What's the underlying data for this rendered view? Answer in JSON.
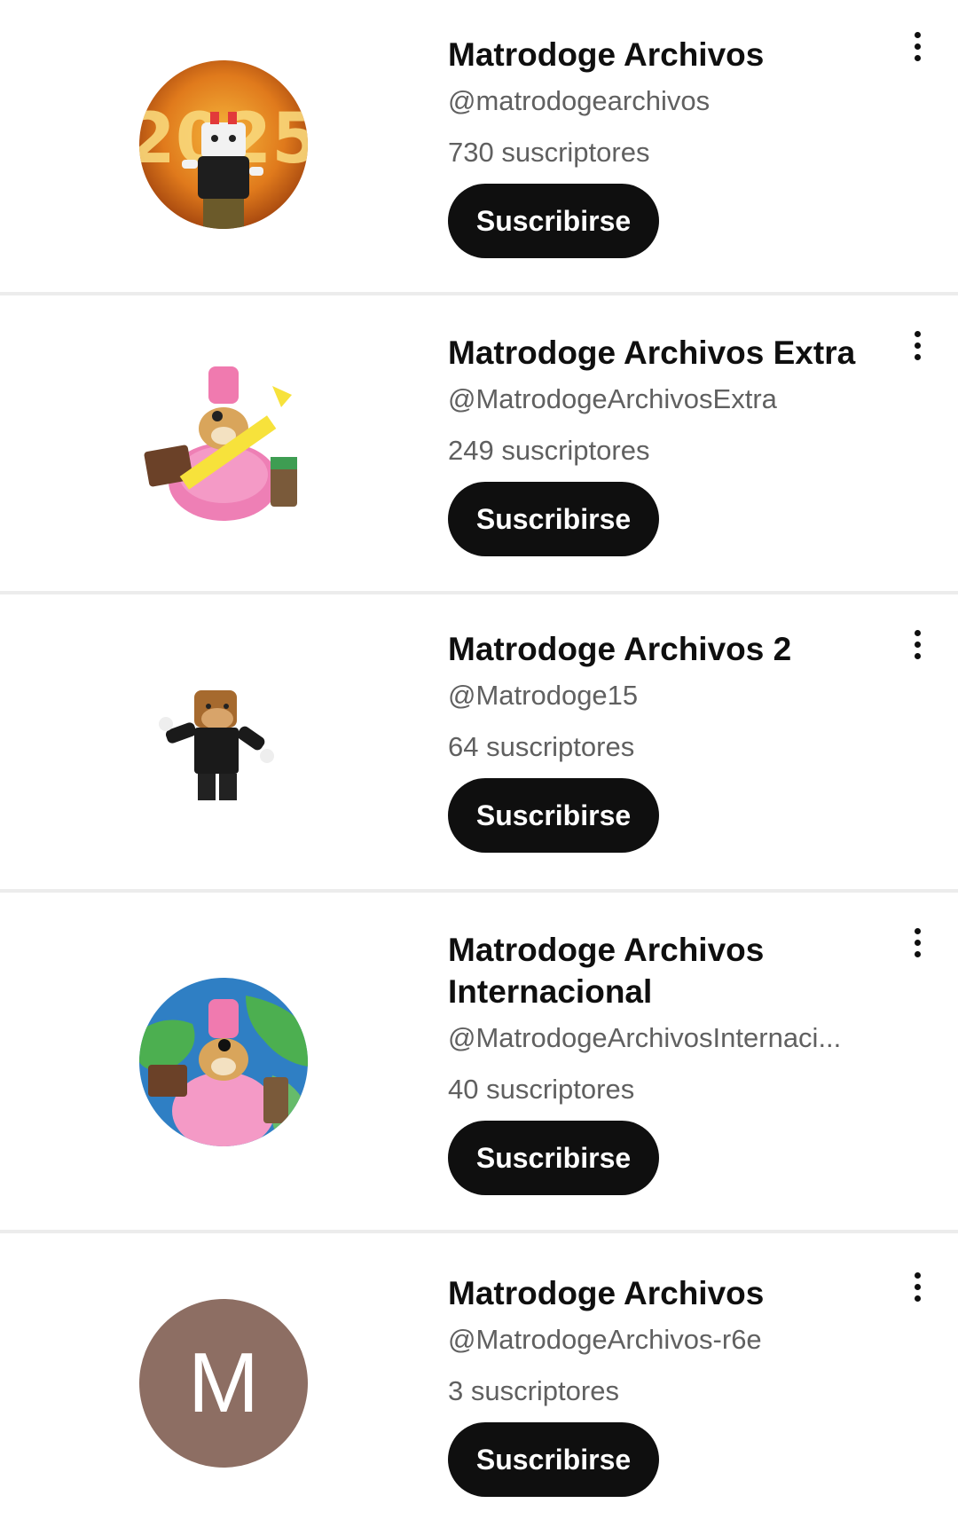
{
  "channels": [
    {
      "name": "Matrodoge Archivos",
      "handle": "@matrodogearchivos",
      "subscribers": "730 suscriptores",
      "button_label": "Suscribirse",
      "avatar_icon": "year-2025-dog-avatar"
    },
    {
      "name": "Matrodoge Archivos Extra",
      "handle": "@MatrodogeArchivosExtra",
      "subscribers": "249 suscriptores",
      "button_label": "Suscribirse",
      "avatar_icon": "pink-flamingo-dog-avatar"
    },
    {
      "name": "Matrodoge Archivos 2",
      "handle": "@Matrodoge15",
      "subscribers": "64 suscriptores",
      "button_label": "Suscribirse",
      "avatar_icon": "roblox-doge-avatar"
    },
    {
      "name_line1": "Matrodoge Archivos",
      "name_line2": "Internacional",
      "handle": "@MatrodogeArchivosInternaci...",
      "subscribers": "40 suscriptores",
      "button_label": "Suscribirse",
      "avatar_icon": "globe-dog-avatar"
    },
    {
      "name": "Matrodoge Archivos",
      "handle": "@MatrodogeArchivos-r6e",
      "subscribers": "3 suscriptores",
      "button_label": "Suscribirse",
      "avatar_letter": "M",
      "avatar_color": "#8d6e63"
    }
  ],
  "colors": {
    "button_bg": "#0f0f0f",
    "secondary_text": "#606060",
    "divider": "#ececec"
  },
  "more_icon": "more-vert-icon"
}
